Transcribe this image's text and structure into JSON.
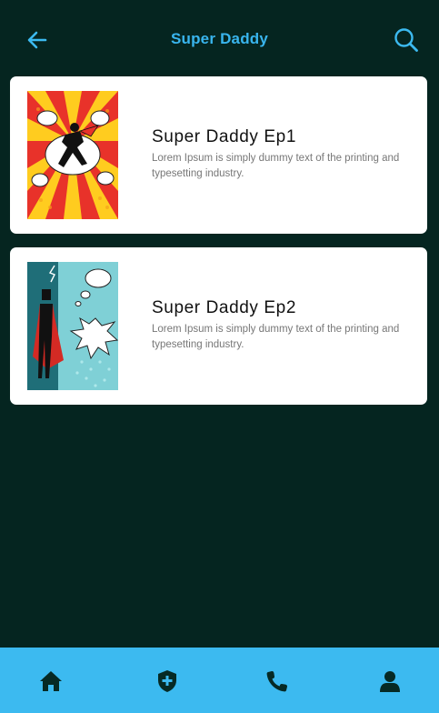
{
  "header": {
    "title": "Super Daddy",
    "back_icon": "arrow-left-icon",
    "search_icon": "search-icon"
  },
  "episodes": [
    {
      "title": "Super Daddy Ep1",
      "description": "Lorem Ipsum is simply dummy text of the printing and typesetting industry.",
      "thumbnail": "comic-burst-thumbnail"
    },
    {
      "title": "Super Daddy Ep2",
      "description": "Lorem Ipsum is simply dummy text of the printing and typesetting industry.",
      "thumbnail": "comic-caped-hero-thumbnail"
    }
  ],
  "bottom_nav": {
    "items": [
      {
        "icon": "home-icon"
      },
      {
        "icon": "shield-plus-icon"
      },
      {
        "icon": "phone-icon"
      },
      {
        "icon": "user-icon"
      }
    ]
  },
  "colors": {
    "background": "#052520",
    "accent": "#3cbaf0",
    "card": "#ffffff"
  }
}
